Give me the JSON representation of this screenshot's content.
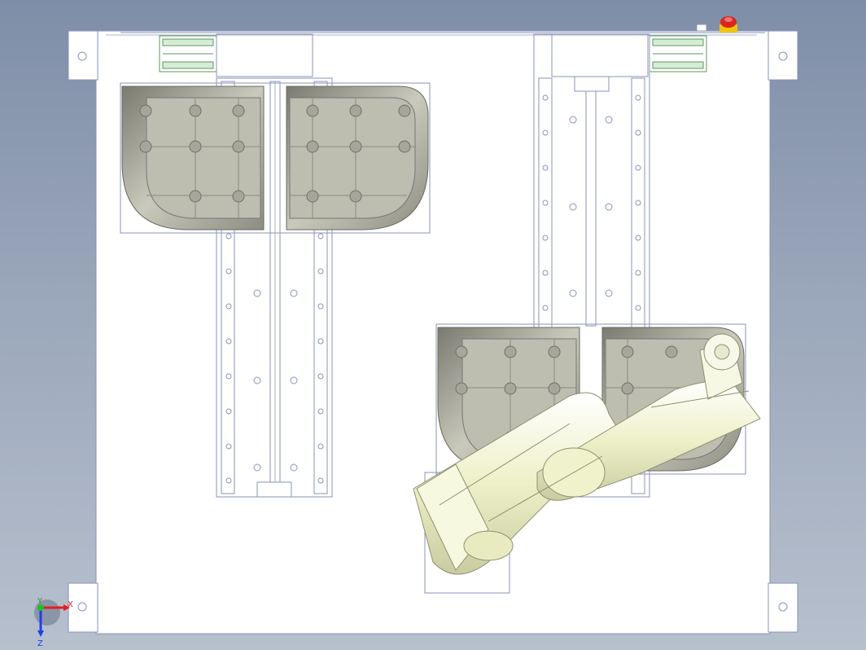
{
  "app": {
    "view": "top-view",
    "background_top": "#7f8ea8",
    "background_bottom": "#b7c0cd"
  },
  "model": {
    "frame_color": "#ffffff",
    "edge_color": "#8a93b8",
    "tray_fill": "#bdbdb0",
    "tray_rim": "#ecece2",
    "robot_color": "#f4f6dc",
    "estop_color": "#d7261e"
  },
  "triad": {
    "x_label": "X",
    "y_label": "Y",
    "z_label": "Z",
    "x_color": "#e02020",
    "y_color": "#20c020",
    "z_color": "#2040e0"
  }
}
